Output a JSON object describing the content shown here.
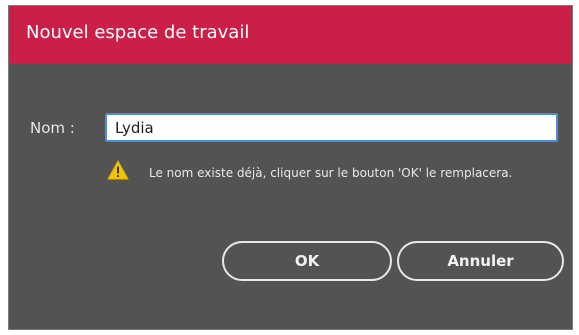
{
  "dialog": {
    "title": "Nouvel espace de travail",
    "name_label": "Nom :",
    "name_value": "Lydia",
    "warning_icon": "warning-triangle-icon",
    "warning_text": "Le nom existe déjà, cliquer sur le bouton 'OK' le remplacera.",
    "ok_label": "OK",
    "cancel_label": "Annuler"
  },
  "colors": {
    "titlebar": "#cc1f48",
    "body": "#535353",
    "warning": "#f5c400",
    "input_focus": "#4a8fd9"
  }
}
